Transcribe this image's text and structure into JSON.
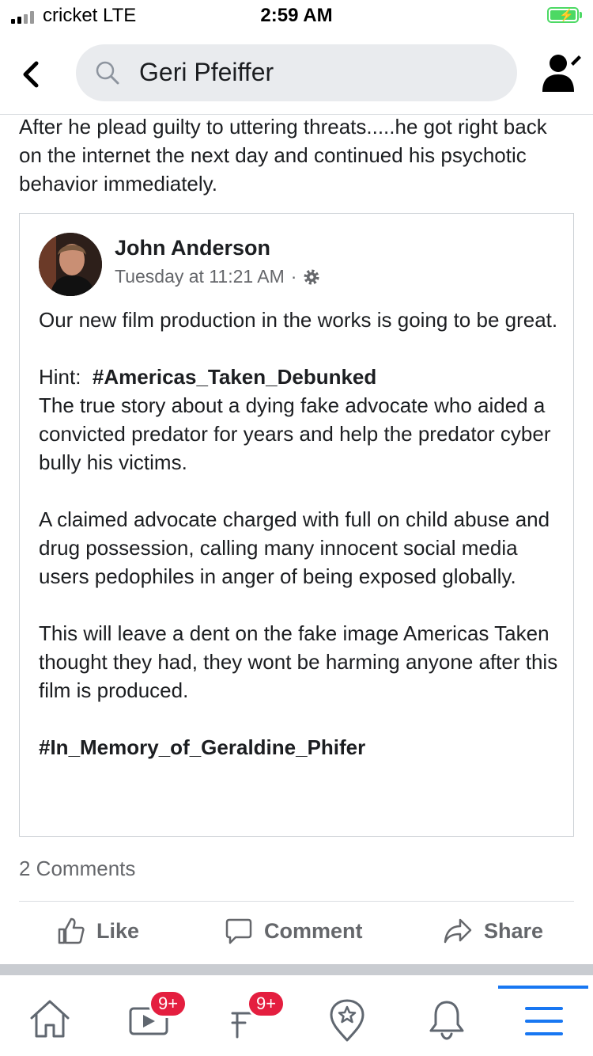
{
  "status_bar": {
    "carrier": "cricket  LTE",
    "time": "2:59 AM"
  },
  "header": {
    "search_value": "Geri Pfeiffer"
  },
  "post": {
    "text": "After he plead guilty to uttering threats.....he got right back on the internet the next day and continued his psychotic behavior immediately."
  },
  "shared_post": {
    "author": "John Anderson",
    "timestamp": "Tuesday at 11:21 AM",
    "separator": "·",
    "para1": "Our new film production in the works is going to be great.",
    "hint_label": "Hint:",
    "hint_tag": "#Americas_Taken_Debunked",
    "para2": "The true story about a dying fake advocate who aided a convicted predator for years and help the predator cyber bully his victims.",
    "para3": "A claimed advocate charged with full on child abuse and drug possession,  calling many innocent social media users pedophiles in anger of being exposed globally.",
    "para4": "This will leave a dent on the fake image Americas Taken thought they had, they wont be harming anyone after this film is produced.",
    "tag": "#In_Memory_of_Geraldine_Phifer"
  },
  "comments_count": "2 Comments",
  "actions": {
    "like": "Like",
    "comment": "Comment",
    "share": "Share"
  },
  "tabbar": {
    "watch_badge": "9+",
    "marketplace_badge": "9+"
  },
  "colors": {
    "accent": "#1877f2",
    "badge": "#e41e3f",
    "battery": "#4cd964"
  }
}
